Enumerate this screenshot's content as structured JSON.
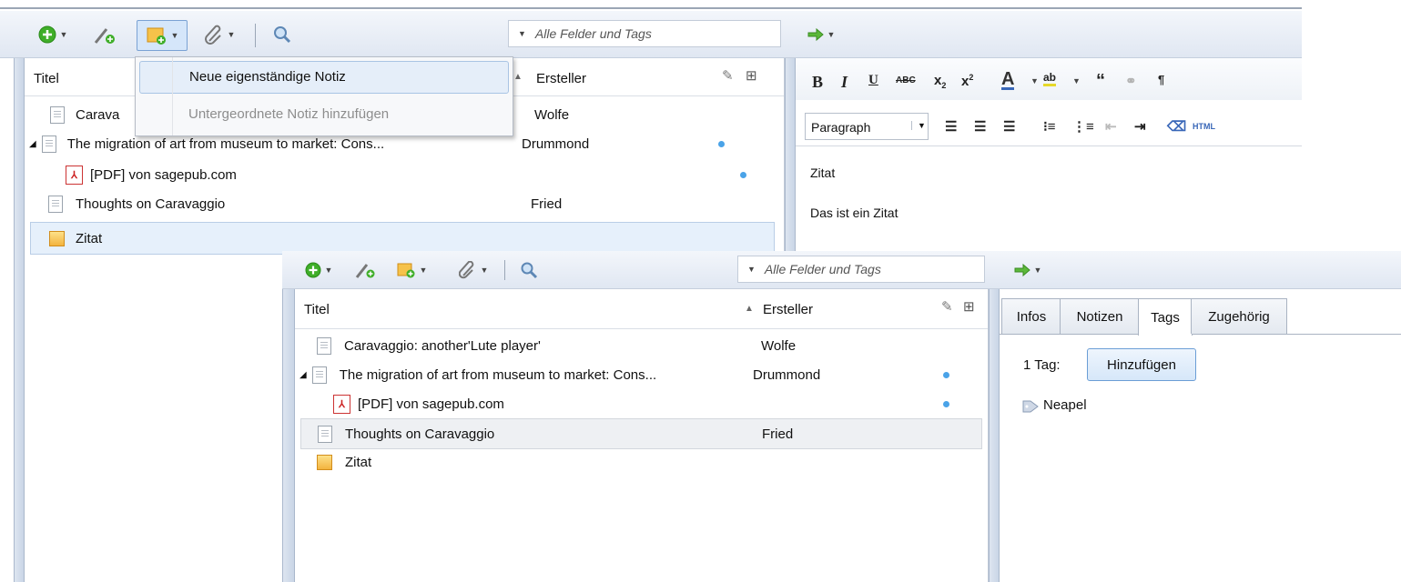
{
  "back": {
    "search_placeholder": "Alle Felder und Tags",
    "columns": {
      "title": "Titel",
      "creator": "Ersteller"
    },
    "rows": [
      {
        "title": "Caravaggio: another'Lute player'",
        "visible_title": "Carava",
        "creator": "Wolfe"
      },
      {
        "title": "The migration of art from museum to market: Cons...",
        "creator": "Drummond"
      },
      {
        "title": "[PDF] von sagepub.com",
        "creator": ""
      },
      {
        "title": "Thoughts on Caravaggio",
        "creator": "Fried"
      },
      {
        "title": "Zitat",
        "creator": ""
      }
    ],
    "dropdown": {
      "item1": "Neue eigenständige Notiz",
      "item2": "Untergeordnete Notiz hinzufügen"
    },
    "editor": {
      "format_select": "Paragraph",
      "html_button": "HTML",
      "lines": [
        "Zitat",
        "Das ist ein Zitat"
      ]
    }
  },
  "front": {
    "search_placeholder": "Alle Felder und Tags",
    "columns": {
      "title": "Titel",
      "creator": "Ersteller"
    },
    "rows": [
      {
        "title": "Caravaggio: another'Lute player'",
        "creator": "Wolfe"
      },
      {
        "title": "The migration of art from museum to market: Cons...",
        "creator": "Drummond"
      },
      {
        "title": "[PDF] von sagepub.com",
        "creator": ""
      },
      {
        "title": "Thoughts on Caravaggio",
        "creator": "Fried"
      },
      {
        "title": "Zitat",
        "creator": ""
      }
    ],
    "tabs": [
      "Infos",
      "Notizen",
      "Tags",
      "Zugehörig"
    ],
    "active_tab": "Tags",
    "tag_count": "1 Tag:",
    "add_button": "Hinzufügen",
    "tags": [
      "Neapel"
    ]
  },
  "colors": {
    "accent_green": "#3fae29",
    "dot_blue": "#4aa3e8",
    "selection": "#e6f0fb"
  }
}
